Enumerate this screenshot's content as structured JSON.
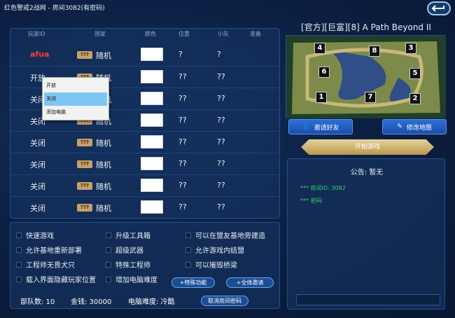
{
  "window": {
    "title": "红色警戒2战网 - 房间3082(有密码)"
  },
  "players": {
    "headers": [
      "玩家ID",
      "国家",
      "颜色",
      "位置",
      "小队",
      "准备"
    ],
    "rows": [
      {
        "id": "afua",
        "country": "随机",
        "position": "?",
        "team": "?"
      },
      {
        "id": "开放",
        "country": "随机",
        "position": "??",
        "team": "??"
      },
      {
        "id": "关闭",
        "country": "随机",
        "position": "??",
        "team": "??"
      },
      {
        "id": "关闭",
        "country": "随机",
        "position": "??",
        "team": "??"
      },
      {
        "id": "关闭",
        "country": "随机",
        "position": "??",
        "team": "??"
      },
      {
        "id": "关闭",
        "country": "随机",
        "position": "??",
        "team": "??"
      },
      {
        "id": "关闭",
        "country": "随机",
        "position": "??",
        "team": "??"
      },
      {
        "id": "关闭",
        "country": "随机",
        "position": "??",
        "team": "??"
      }
    ],
    "qlabel": "???"
  },
  "context_menu": {
    "items": [
      "开放",
      "关闭",
      "添加电脑"
    ]
  },
  "map": {
    "name": "[官方][巨富][8] A Path Beyond II",
    "slots": [
      "4",
      "8",
      "3",
      "6",
      "5",
      "1",
      "7",
      "2"
    ]
  },
  "buttons": {
    "invite": "邀请好友",
    "modify_map": "修改地图",
    "start": "开始游戏",
    "special": "+特殊功能",
    "invite_all": "+全体邀请",
    "cancel_pw": "取消房间密码"
  },
  "announcement": {
    "title": "公告: 暂无",
    "room_id": "*** 房间ID: 3082",
    "password": "*** 密码:"
  },
  "options": {
    "col1": [
      "快速游戏",
      "允许基地重新部署",
      "工程师无畏犬只",
      "载入界面隐藏玩家位置"
    ],
    "col2": [
      "升级工具箱",
      "超级武器",
      "特殊工程师",
      "增加电脑难度"
    ],
    "col3": [
      "可以在盟友基地旁建造",
      "允许游戏内结盟",
      "可以摧毁桥梁"
    ]
  },
  "status": {
    "units": "部队数: 10",
    "money": "金钱: 30000",
    "ai": "电脑难度: 冷酷"
  }
}
